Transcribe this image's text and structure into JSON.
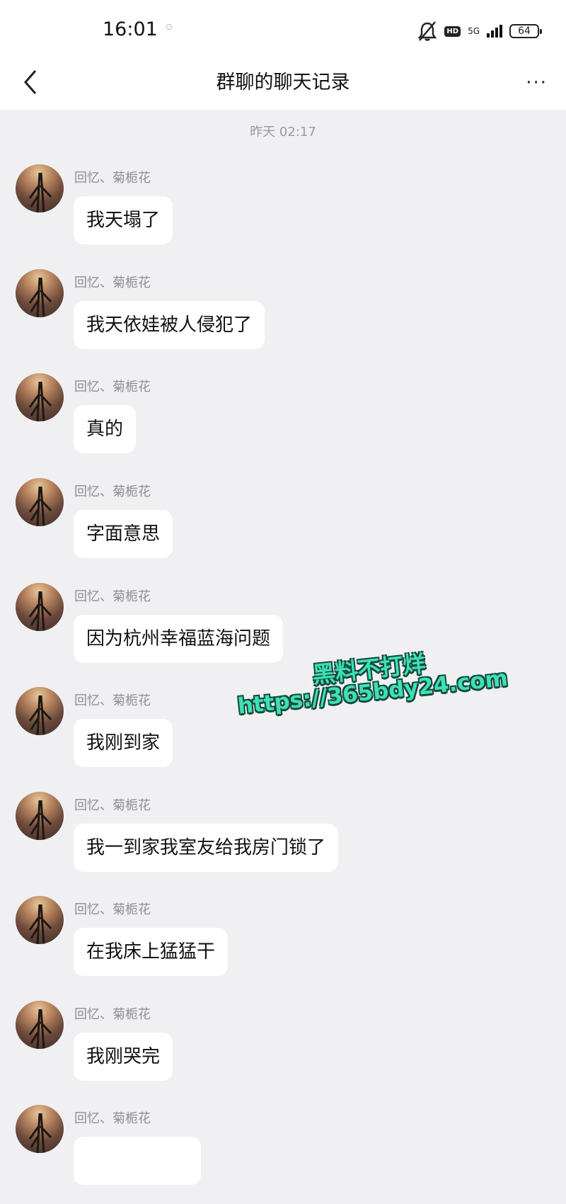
{
  "status_bar": {
    "time": "16:01",
    "network": "5G",
    "battery": "64"
  },
  "header": {
    "back_icon": "chevron-left-icon",
    "title": "群聊的聊天记录",
    "more_icon": "more-horizontal-icon",
    "more_label": "···"
  },
  "chat": {
    "timestamp": "昨天 02:17",
    "messages": [
      {
        "sender": "回忆、菊栀花",
        "text": "我天塌了"
      },
      {
        "sender": "回忆、菊栀花",
        "text": "我天依娃被人侵犯了"
      },
      {
        "sender": "回忆、菊栀花",
        "text": "真的"
      },
      {
        "sender": "回忆、菊栀花",
        "text": "字面意思"
      },
      {
        "sender": "回忆、菊栀花",
        "text": "因为杭州幸福蓝海问题"
      },
      {
        "sender": "回忆、菊栀花",
        "text": "我刚到家"
      },
      {
        "sender": "回忆、菊栀花",
        "text": "我一到家我室友给我房门锁了"
      },
      {
        "sender": "回忆、菊栀花",
        "text": "在我床上猛猛干"
      },
      {
        "sender": "回忆、菊栀花",
        "text": "我刚哭完"
      },
      {
        "sender": "回忆、菊栀花",
        "text": ""
      }
    ]
  },
  "watermark": {
    "line1": "黑料不打烊",
    "line2": "https://365bdy24.com"
  },
  "colors": {
    "background": "#f0f0f3",
    "bubble": "#ffffff",
    "watermark": "#3fe0b6"
  }
}
